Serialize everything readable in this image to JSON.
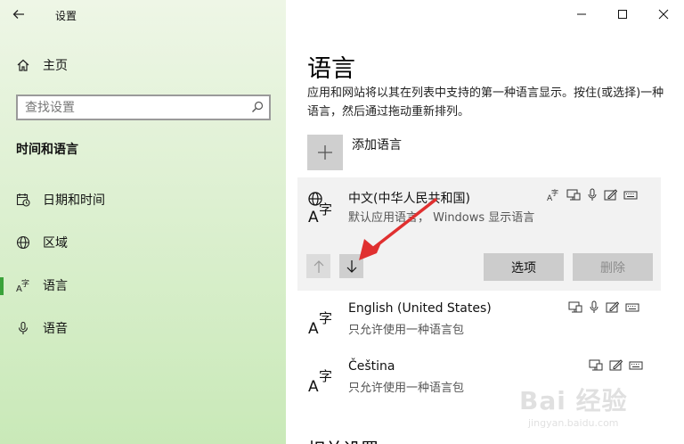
{
  "window": {
    "app_title": "设置",
    "controls": [
      "minimize",
      "maximize",
      "close"
    ]
  },
  "nav": {
    "home_label": "主页",
    "search_placeholder": "查找设置",
    "section_title": "时间和语言",
    "items": [
      {
        "label": "日期和时间",
        "icon": "date-time-icon"
      },
      {
        "label": "区域",
        "icon": "globe-icon"
      },
      {
        "label": "语言",
        "icon": "language-icon",
        "selected": true
      },
      {
        "label": "语音",
        "icon": "microphone-icon"
      }
    ]
  },
  "main": {
    "title": "语言",
    "description": "应用和网站将以其在列表中支持的第一种语言显示。按住(或选择)一种语言，然后通过拖动重新排列。",
    "add_language_label": "添加语言",
    "languages": [
      {
        "name": "中文(中华人民共和国)",
        "subtitle": "默认应用语言， Windows 显示语言",
        "features": [
          "language-pack-icon",
          "display-icon",
          "speech-icon",
          "handwriting-icon",
          "keyboard-icon"
        ]
      },
      {
        "name": "English (United States)",
        "subtitle": "只允许使用一种语言包",
        "features": [
          "display-icon",
          "speech-icon",
          "handwriting-icon",
          "keyboard-icon"
        ]
      },
      {
        "name": "Čeština",
        "subtitle": "只允许使用一种语言包",
        "features": [
          "display-icon",
          "handwriting-icon",
          "keyboard-icon"
        ]
      }
    ],
    "options_button": "选项",
    "remove_button": "删除",
    "partial_heading": "相关设置"
  },
  "watermark": {
    "logo": "Bai 经验",
    "url": "jingyan.baidu.com"
  },
  "colors": {
    "nav_gradient_top": "#eef6e6",
    "nav_gradient_bottom": "#c9e9b8",
    "selected_indicator": "#3aa23a",
    "annotation_arrow": "#e03030"
  }
}
